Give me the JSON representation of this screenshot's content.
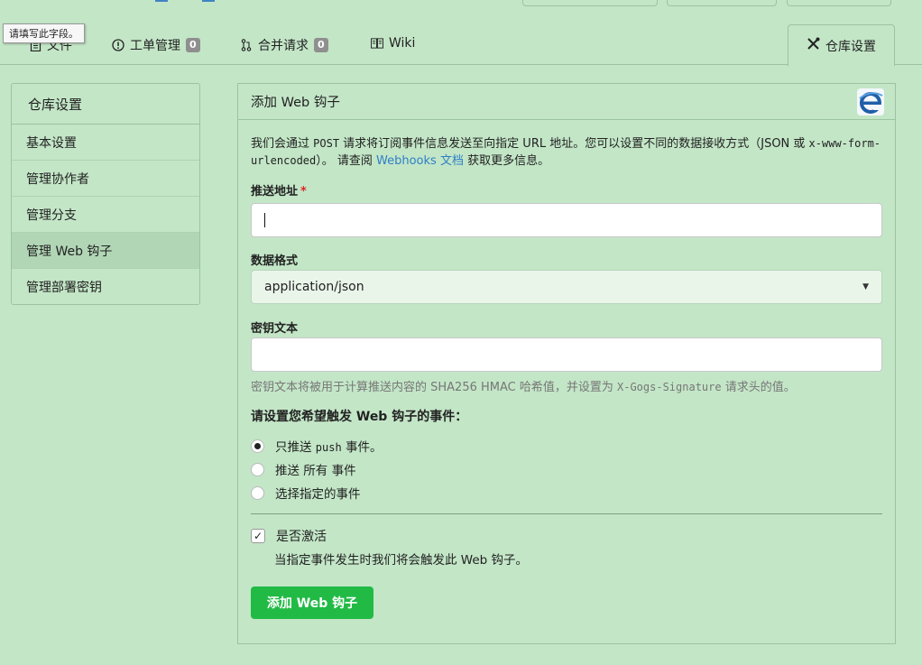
{
  "tooltip": "请填写此字段。",
  "tabs": [
    {
      "label": "文件",
      "icon": "file-text-icon"
    },
    {
      "label": "工单管理",
      "icon": "issue-icon",
      "badge": "0"
    },
    {
      "label": "合并请求",
      "icon": "pull-request-icon",
      "badge": "0"
    },
    {
      "label": "Wiki",
      "icon": "book-icon"
    }
  ],
  "active_tab": {
    "label": "仓库设置",
    "icon": "tools-icon"
  },
  "sidebar": {
    "title": "仓库设置",
    "items": [
      {
        "label": "基本设置"
      },
      {
        "label": "管理协作者"
      },
      {
        "label": "管理分支"
      },
      {
        "label": "管理 Web 钩子",
        "active": true
      },
      {
        "label": "管理部署密钥"
      }
    ]
  },
  "panel": {
    "title": "添加 Web 钩子",
    "intro_1": "我们会通过 ",
    "intro_post": "POST",
    "intro_2": " 请求将订阅事件信息发送至向指定 URL 地址。您可以设置不同的数据接收方式（JSON 或 ",
    "intro_urlencoded": "x-www-form-urlencoded",
    "intro_3": "）。 请查阅 ",
    "intro_link": "Webhooks 文档",
    "intro_4": " 获取更多信息。",
    "payload_url_label": "推送地址",
    "payload_url_value": "",
    "content_type_label": "数据格式",
    "content_type_value": "application/json",
    "secret_label": "密钥文本",
    "secret_value": "",
    "secret_help_1": "密钥文本将被用于计算推送内容的 SHA256 HMAC 哈希值，并设置为 ",
    "secret_help_code": "X-Gogs-Signature",
    "secret_help_2": " 请求头的值。",
    "events_title": "请设置您希望触发 Web 钩子的事件：",
    "event_options": [
      {
        "label_1": "只推送 ",
        "code": "push",
        "label_2": " 事件。",
        "checked": true
      },
      {
        "label_1": "推送 所有 事件",
        "checked": false
      },
      {
        "label_1": "选择指定的事件",
        "checked": false
      }
    ],
    "active_label": "是否激活",
    "active_checked": true,
    "active_help": "当指定事件发生时我们将会触发此 Web 钩子。",
    "submit_label": "添加 Web 钩子"
  },
  "colors": {
    "background": "#c3e6c7",
    "primary_button": "#21ba45",
    "link": "#2f7fc6",
    "required": "#db2828"
  }
}
